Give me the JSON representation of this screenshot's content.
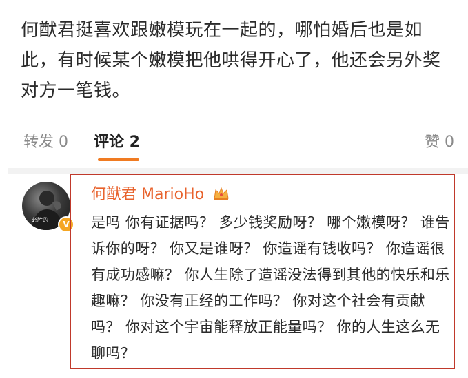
{
  "post": {
    "text": "何猷君挺喜欢跟嫩模玩在一起的，哪怕婚后也是如此，有时候某个嫩模把他哄得开心了，他还会另外奖对方一笔钱。"
  },
  "tabs": {
    "repost": "转发 0",
    "comment": "评论 2",
    "like": "赞 0"
  },
  "comment": {
    "username": "何猷君 MarioHo",
    "avatar_caption": "必胜的",
    "body": "是吗 你有证据吗？ 多少钱奖励呀？ 哪个嫩模呀？ 谁告诉你的呀？ 你又是谁呀？ 你造谣有钱收吗？ 你造谣很有成功感嘛？ 你人生除了造谣没法得到其他的快乐和乐趣嘛？ 你没有正经的工作吗？ 你对这个社会有贡献吗？ 你对这个宇宙能释放正能量吗？ 你的人生这么无聊吗？"
  },
  "colors": {
    "accent_orange": "#f07b22",
    "username_color": "#e8622c",
    "highlight_border": "#c0392b"
  }
}
